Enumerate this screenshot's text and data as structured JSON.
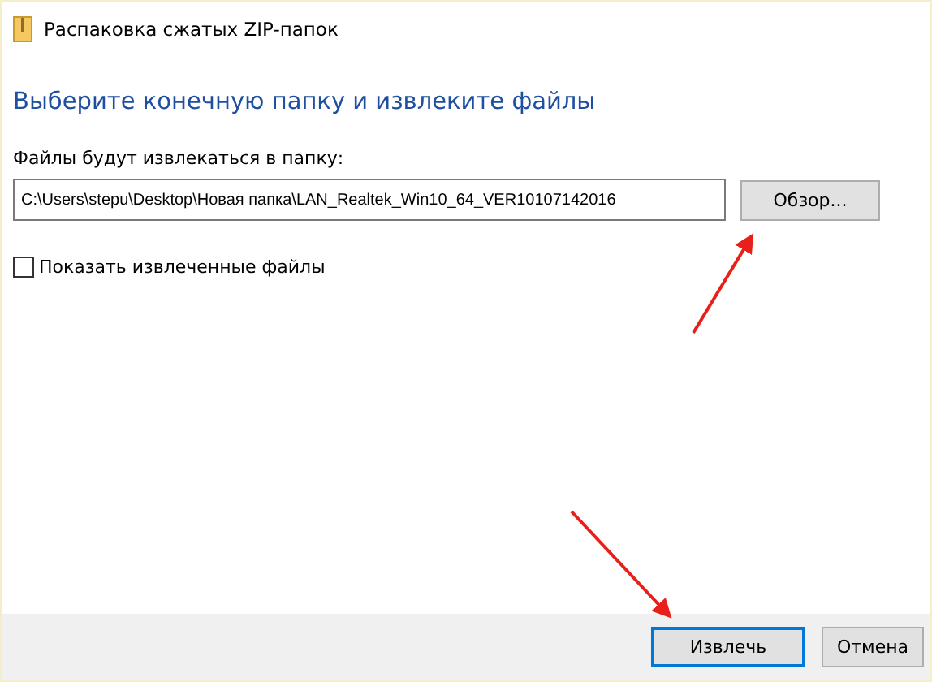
{
  "window": {
    "title": "Распаковка сжатых ZIP-папок"
  },
  "heading": "Выберите конечную папку и извлеките файлы",
  "destination": {
    "label": "Файлы будут извлекаться в папку:",
    "value": "C:\\Users\\stepu\\Desktop\\Новая папка\\LAN_Realtek_Win10_64_VER10107142016",
    "browse_button": "Обзор..."
  },
  "show_files": {
    "label": "Показать извлеченные файлы",
    "checked": false
  },
  "buttons": [
    {
      "label": "Извлечь",
      "default": true
    },
    {
      "label": "Отмена",
      "default": false
    }
  ]
}
